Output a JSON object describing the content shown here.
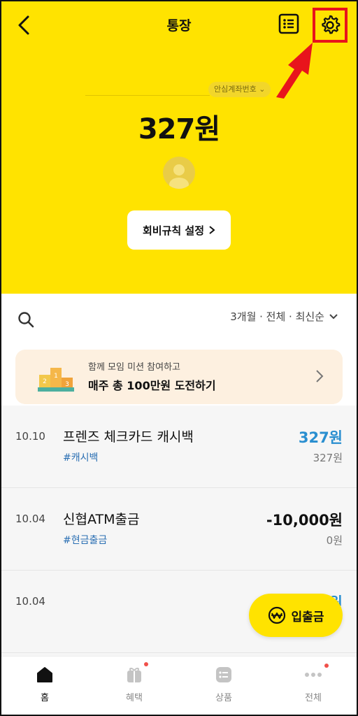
{
  "header": {
    "title": "통장",
    "back_icon": "back-chevron-icon",
    "list_icon": "list-icon",
    "settings_icon": "gear-icon",
    "highlight_color": "#e8141c"
  },
  "account": {
    "number_chip": "안심계좌번호",
    "balance": "327원",
    "rule_button": "회비규칙 설정"
  },
  "filter": {
    "label": "3개월 · 전체 · 최신순"
  },
  "banner": {
    "subtitle": "함께 모임 미션 참여하고",
    "title": "매주 총 100만원 도전하기",
    "background": "#fdf0e0"
  },
  "transactions": [
    {
      "date": "10.10",
      "name": "프렌즈 체크카드 캐시백",
      "tag": "#캐시백",
      "amount": "327원",
      "balance": "327원",
      "amount_color": "#2a8fd0"
    },
    {
      "date": "10.04",
      "name": "신협ATM출금",
      "tag": "#현금출금",
      "amount": "-10,000원",
      "balance": "0원",
      "amount_color": "#111111"
    },
    {
      "date": "10.04",
      "name": "",
      "tag": "",
      "amount": "원",
      "balance": "",
      "amount_color": "#2a8fd0"
    }
  ],
  "fab": {
    "label": "입출금",
    "icon": "won-icon"
  },
  "nav": [
    {
      "label": "홈",
      "icon": "home-icon",
      "active": true
    },
    {
      "label": "혜택",
      "icon": "gift-icon",
      "badge": true
    },
    {
      "label": "상품",
      "icon": "product-icon"
    },
    {
      "label": "전체",
      "icon": "more-icon",
      "badge": true
    }
  ],
  "colors": {
    "brand_yellow": "#ffe300",
    "blue_amount": "#2a8fd0",
    "badge_red": "#f0504a"
  }
}
